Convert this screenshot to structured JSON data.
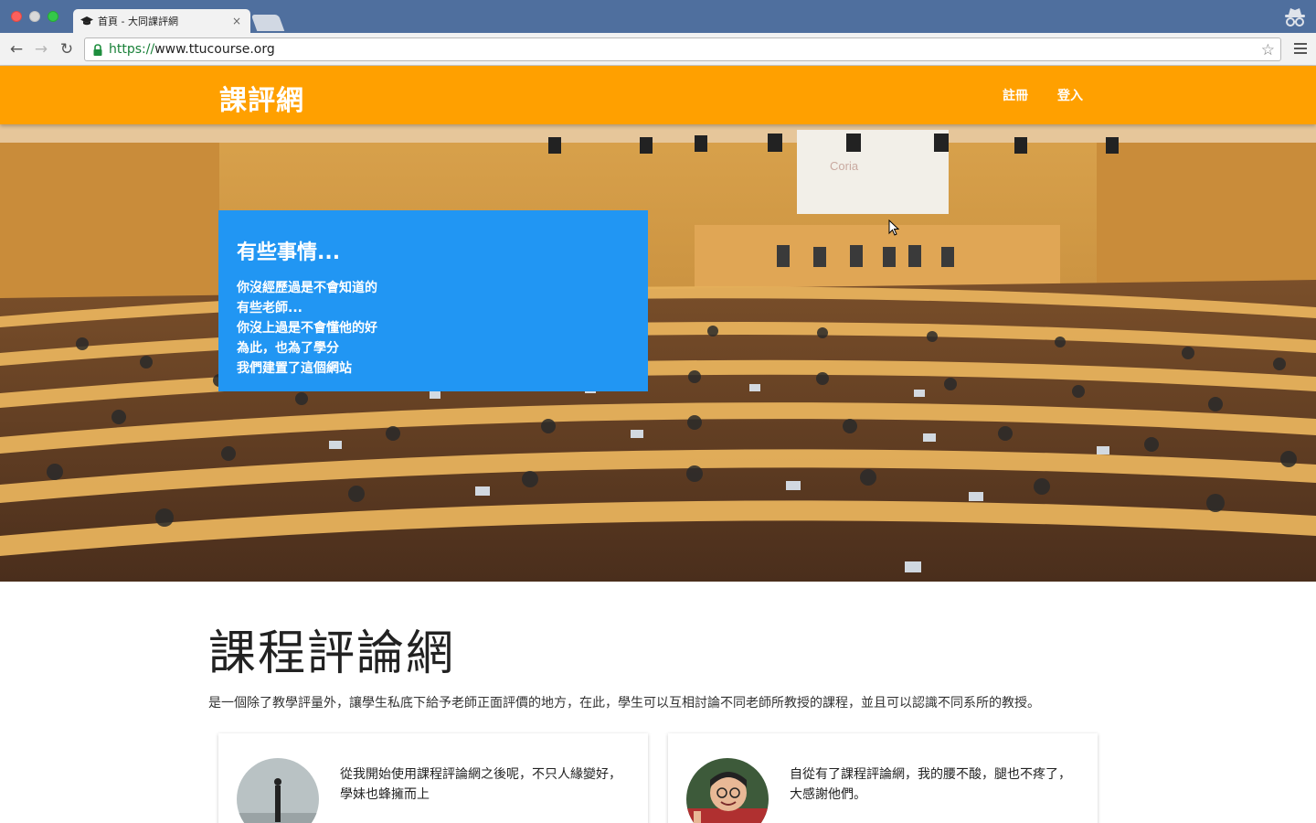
{
  "browser": {
    "tab_title": "首頁 - 大同課評網",
    "tab_close": "×",
    "url_scheme": "https://",
    "url_host": "www.ttucourse.org",
    "back_glyph": "←",
    "forward_glyph": "→",
    "reload_glyph": "↻",
    "star_glyph": "☆"
  },
  "header": {
    "brand": "課評網",
    "nav": {
      "register": "註冊",
      "login": "登入"
    },
    "color": "#ffa000"
  },
  "hero": {
    "card_color": "#2196f3",
    "title": "有些事情...",
    "lines": [
      "你沒經歷過是不會知道的",
      "有些老師...",
      "你沒上過是不會懂他的好",
      "為此，也為了學分",
      "我們建置了這個網站"
    ]
  },
  "main": {
    "title": "課程評論網",
    "description": "是一個除了教學評量外，讓學生私底下給予老師正面評價的地方，在此，學生可以互相討論不同老師所教授的課程，並且可以認識不同系所的教授。"
  },
  "testimonials": [
    {
      "quote": "從我開始使用課程評論網之後呢，不只人緣變好，學妹也蜂擁而上",
      "author": ""
    },
    {
      "quote": "自從有了課程評論網，我的腰不酸，腿也不疼了，大感謝他們。",
      "author": ""
    }
  ]
}
